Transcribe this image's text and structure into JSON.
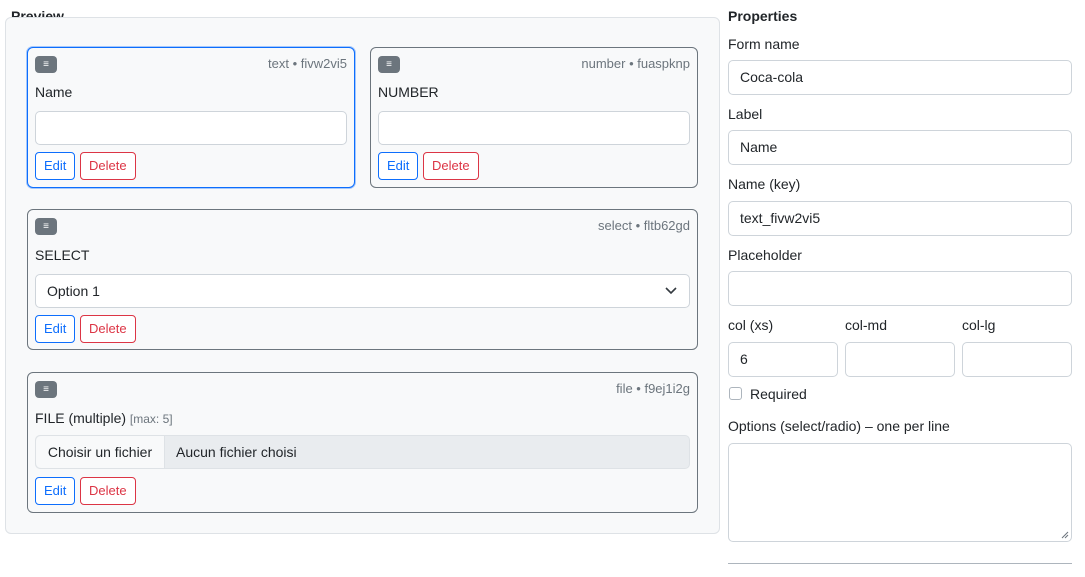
{
  "preview": {
    "title": "Preview",
    "fields": [
      {
        "meta": "text • fivw2vi5",
        "label": "Name",
        "handle_icon": "drag-handle-icon"
      },
      {
        "meta": "number • fuaspknp",
        "label": "NUMBER",
        "handle_icon": "drag-handle-icon"
      },
      {
        "meta": "select • fltb62gd",
        "label": "SELECT",
        "selected_option": "Option 1",
        "handle_icon": "drag-handle-icon"
      },
      {
        "meta": "file • f9ej1i2g",
        "label": "FILE (multiple)",
        "hint": "[max: 5]",
        "choose_label": "Choisir un fichier",
        "no_file_label": "Aucun fichier choisi",
        "handle_icon": "drag-handle-icon"
      }
    ],
    "edit_label": "Edit",
    "delete_label": "Delete",
    "handle_glyph": "≡"
  },
  "properties": {
    "title": "Properties",
    "form_name_label": "Form name",
    "form_name_value": "Coca-cola",
    "label_label": "Label",
    "label_value": "Name",
    "key_label": "Name (key)",
    "key_value": "text_fivw2vi5",
    "placeholder_label": "Placeholder",
    "placeholder_value": "",
    "col_xs_label": "col (xs)",
    "col_xs_value": "6",
    "col_md_label": "col-md",
    "col_md_value": "",
    "col_lg_label": "col-lg",
    "col_lg_value": "",
    "required_label": "Required",
    "required_checked": false,
    "options_label": "Options (select/radio) – one per line",
    "options_value": ""
  },
  "colors": {
    "primary": "#0d6efd",
    "danger": "#dc3545",
    "secondary": "#6c757d"
  }
}
